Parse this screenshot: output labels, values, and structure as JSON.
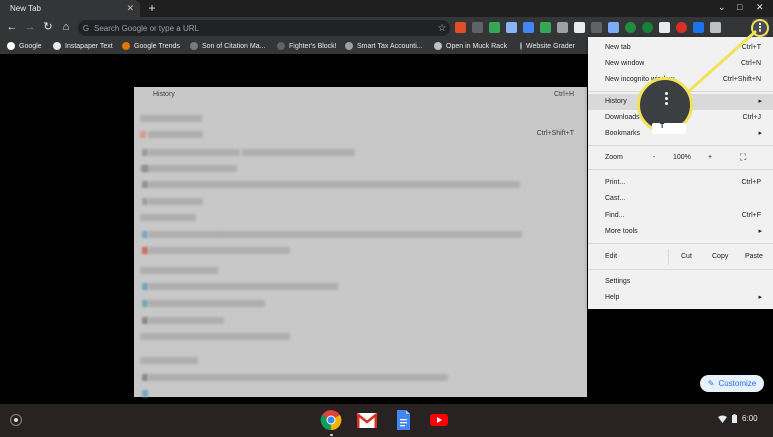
{
  "tab": {
    "title": "New Tab",
    "close": "✕",
    "new_tab": "+"
  },
  "window_controls": [
    "⌄",
    "□",
    "✕"
  ],
  "omnibox": {
    "placeholder": "Search Google or type a URL",
    "star": "☆"
  },
  "toolbar": {
    "back": "←",
    "forward": "→",
    "reload": "↻",
    "home": "⌂",
    "menu": "⋮"
  },
  "bookmarks": [
    {
      "label": "Google",
      "color": "#ffffff"
    },
    {
      "label": "Instapaper Text",
      "color": "#e8eaed"
    },
    {
      "label": "Google Trends",
      "color": "#e37400"
    },
    {
      "label": "Son of Citation Ma...",
      "color": "#7a7a7a"
    },
    {
      "label": "Fighter's Block!",
      "color": "#5f6368"
    },
    {
      "label": "Smart Tax Accounti...",
      "color": "#9aa0a6"
    },
    {
      "label": "Open in Muck Rack",
      "color": "#bdc1c6"
    },
    {
      "label": "Website Grader",
      "color": "#9aa0a6"
    }
  ],
  "history_panel": {
    "title": "History",
    "shortcut": "Ctrl+H",
    "shortcut2": "Ctrl+Shift+T"
  },
  "menu": {
    "new_tab": {
      "label": "New tab",
      "shortcut": "Ctrl+T"
    },
    "new_window": {
      "label": "New window",
      "shortcut": "Ctrl+N"
    },
    "new_incognito": {
      "label": "New incognito window",
      "shortcut": "Ctrl+Shift+N"
    },
    "history": {
      "label": "History"
    },
    "downloads": {
      "label": "Downloads",
      "shortcut": "Ctrl+J"
    },
    "bookmarks": {
      "label": "Bookmarks"
    },
    "zoom": {
      "label": "Zoom",
      "minus": "-",
      "value": "100%",
      "plus": "+",
      "fullscreen": "⛶"
    },
    "print": {
      "label": "Print...",
      "shortcut": "Ctrl+P"
    },
    "cast": {
      "label": "Cast..."
    },
    "find": {
      "label": "Find...",
      "shortcut": "Ctrl+F"
    },
    "more_tools": {
      "label": "More tools"
    },
    "edit": {
      "label": "Edit",
      "cut": "Cut",
      "copy": "Copy",
      "paste": "Paste"
    },
    "settings": {
      "label": "Settings"
    },
    "help": {
      "label": "Help"
    },
    "arrow": "▸"
  },
  "customize": {
    "label": "Customize",
    "icon": "✎"
  },
  "tray": {
    "time": "6:00"
  },
  "colors": {
    "accent": "#1a73e8",
    "callout": "#f2e25a"
  },
  "icons": [
    "launcher-icon",
    "chrome-icon",
    "gmail-icon",
    "docs-icon",
    "youtube-icon",
    "wifi-icon",
    "battery-icon"
  ]
}
